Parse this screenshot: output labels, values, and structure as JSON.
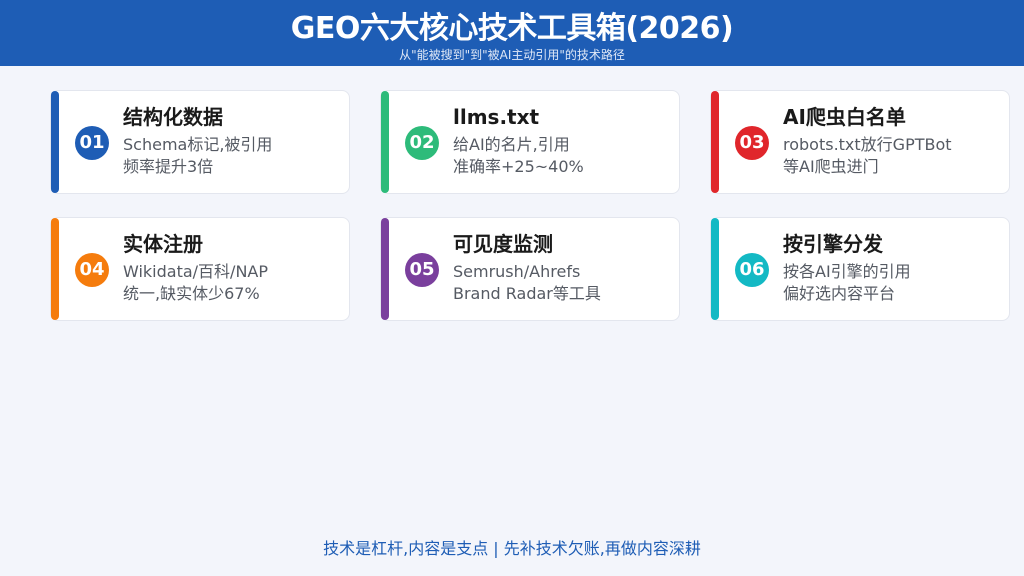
{
  "header": {
    "title": "GEO六大核心技术工具箱(2026)",
    "subtitle": "从\"能被搜到\"到\"被AI主动引用\"的技术路径"
  },
  "cards": [
    {
      "num": "01",
      "title": "结构化数据",
      "desc1": "Schema标记,被引用",
      "desc2": "频率提升3倍",
      "color": "#1e5db5"
    },
    {
      "num": "02",
      "title": "llms.txt",
      "desc1": "给AI的名片,引用",
      "desc2": "准确率+25~40%",
      "color": "#2dbb7a"
    },
    {
      "num": "03",
      "title": "AI爬虫白名单",
      "desc1": "robots.txt放行GPTBot",
      "desc2": "等AI爬虫进门",
      "color": "#e0262b"
    },
    {
      "num": "04",
      "title": "实体注册",
      "desc1": "Wikidata/百科/NAP",
      "desc2": "统一,缺实体少67%",
      "color": "#f57c0d"
    },
    {
      "num": "05",
      "title": "可见度监测",
      "desc1": "Semrush/Ahrefs",
      "desc2": "Brand Radar等工具",
      "color": "#7a3f9d"
    },
    {
      "num": "06",
      "title": "按引擎分发",
      "desc1": "按各AI引擎的引用",
      "desc2": "偏好选内容平台",
      "color": "#13b9c4"
    }
  ],
  "footer": {
    "text": "技术是杠杆,内容是支点 | 先补技术欠账,再做内容深耕"
  }
}
